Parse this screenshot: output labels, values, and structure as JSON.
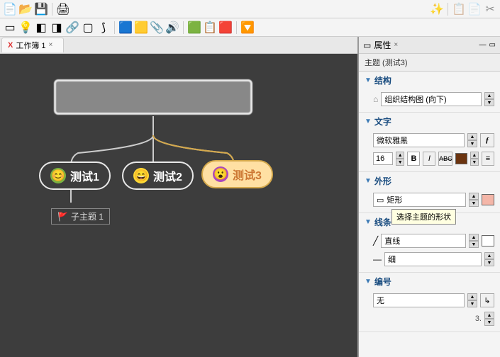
{
  "tab": {
    "label": "工作簿 1"
  },
  "nodes": {
    "child1": "测试1",
    "child2": "测试2",
    "child3": "测试3",
    "sub1": "子主题 1"
  },
  "props": {
    "title": "属性",
    "subject": "主题 (测试3)",
    "structure": {
      "title": "结构",
      "value": "组织结构图 (向下)"
    },
    "text": {
      "title": "文字",
      "font": "微软雅黑",
      "size": "16"
    },
    "shape": {
      "title": "外形",
      "value": "矩形",
      "tooltip": "选择主题的形状"
    },
    "line": {
      "title": "线条",
      "style": "直线",
      "weight": "细"
    },
    "number": {
      "title": "编号",
      "value": "无"
    },
    "depth": "3."
  }
}
